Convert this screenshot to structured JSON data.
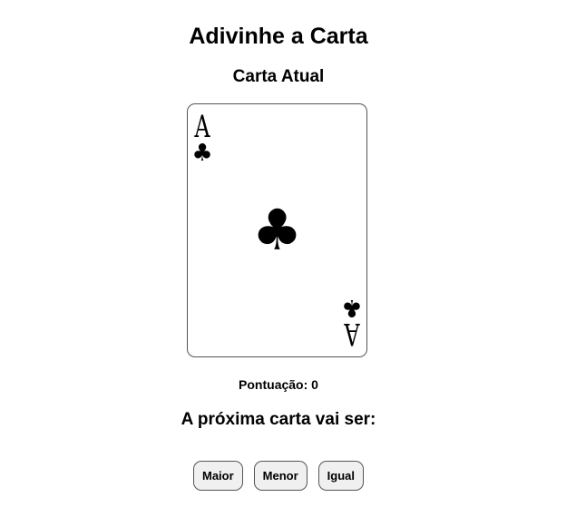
{
  "page": {
    "title": "Adivinhe a Carta",
    "subtitle": "Carta Atual"
  },
  "card": {
    "rank": "A",
    "suit_glyph": "♣",
    "suit_icon": "club-suit-icon"
  },
  "score": {
    "text": "Pontuação: 0"
  },
  "question": {
    "text": "A próxima carta vai ser:"
  },
  "buttons": {
    "higher_label": "Maior",
    "lower_label": "Menor",
    "equal_label": "Igual"
  }
}
